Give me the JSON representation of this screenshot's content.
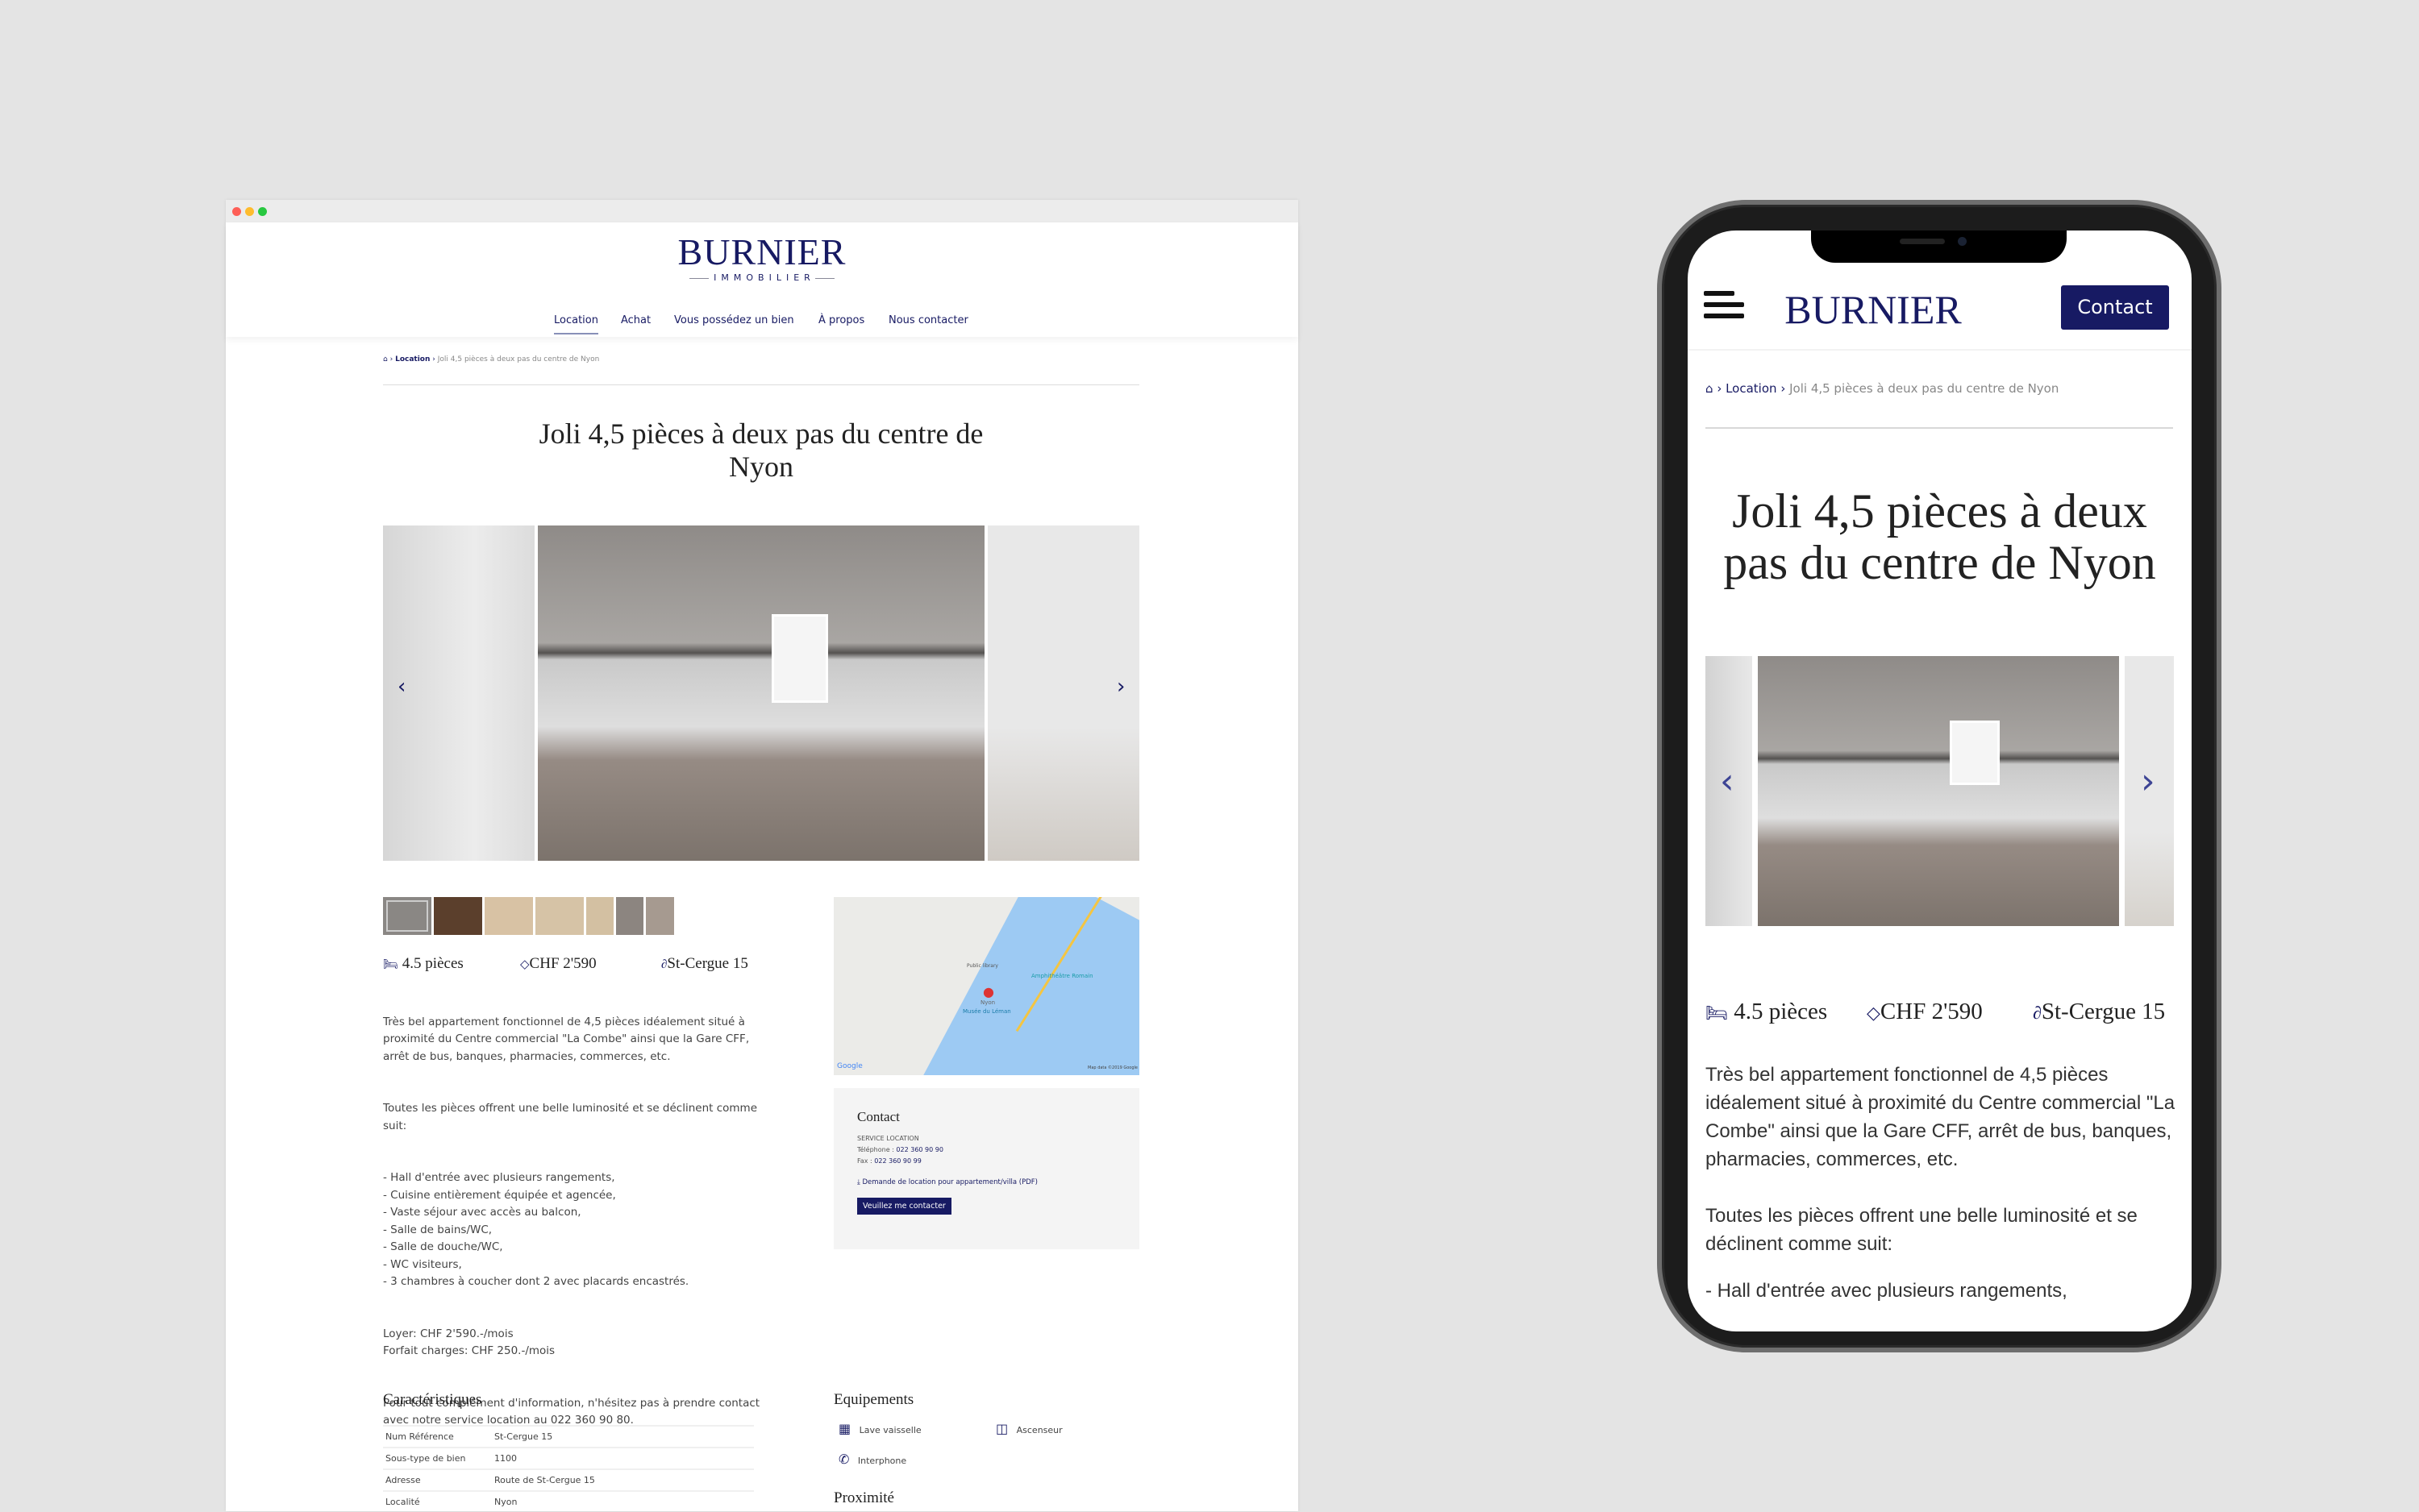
{
  "brand": {
    "name": "BURNIER",
    "tagline": "IMMOBILIER",
    "accent": "#171a63"
  },
  "nav": [
    "Location",
    "Achat",
    "Vous possédez un bien",
    "À propos",
    "Nous contacter"
  ],
  "breadcrumb": {
    "home": "home-icon",
    "section": "Location",
    "current": "Joli 4,5 pièces à deux pas du centre de Nyon"
  },
  "title": "Joli 4,5 pièces à deux pas du centre de Nyon",
  "specs": {
    "rooms": "4.5 pièces",
    "price": "CHF 2'590",
    "ref": "St-Cergue 15"
  },
  "description": {
    "p1": "Très bel appartement fonctionnel de 4,5 pièces idéalement situé à proximité du Centre commercial \"La Combe\" ainsi que la Gare CFF, arrêt de bus, banques, pharmacies, commerces, etc.",
    "p2": "Toutes les pièces offrent une belle luminosité et se déclinent comme suit:",
    "list": [
      "- Hall d'entrée avec plusieurs rangements,",
      "- Cuisine entièrement équipée et agencée,",
      "- Vaste séjour avec accès au balcon,",
      "- Salle de bains/WC,",
      "- Salle de douche/WC,",
      "- WC visiteurs,",
      "- 3 chambres à coucher dont 2 avec placards encastrés."
    ],
    "p3": "Loyer: CHF 2'590.-/mois\nForfait charges: CHF 250.-/mois",
    "p4": "Pour tout complément d'information, n'hésitez pas à prendre contact avec notre service location au 022 360 90 80."
  },
  "map": {
    "labels": [
      "Public library",
      "Nyon",
      "Amphithéâtre Romain",
      "Musée du Léman"
    ],
    "google": "Google",
    "attribution": "Map data ©2019 Google"
  },
  "contact": {
    "heading": "Contact",
    "service": "SERVICE LOCATION",
    "phone_label": "Téléphone : ",
    "phone": "022 360 90 90",
    "fax_label": "Fax : ",
    "fax": "022 360 90 99",
    "pdf": "Demande de location pour appartement/villa (PDF)",
    "button": "Veuillez me contacter"
  },
  "characteristics": {
    "heading": "Caractéristiques",
    "rows": [
      [
        "Num Référence",
        "St-Cergue 15"
      ],
      [
        "Sous-type de bien",
        "1100"
      ],
      [
        "Adresse",
        "Route de St-Cergue 15"
      ],
      [
        "Localité",
        "Nyon"
      ]
    ]
  },
  "equipment": {
    "heading": "Equipements",
    "items": [
      "Lave vaisselle",
      "Ascenseur",
      "Interphone"
    ]
  },
  "proximity": {
    "heading": "Proximité"
  },
  "mobile": {
    "contact_button": "Contact",
    "text_p1": "Très bel appartement fonctionnel de 4,5 pièces idéalement situé à proximité du Centre commercial \"La Combe\" ainsi que la Gare CFF, arrêt de bus, banques, pharmacies, commerces, etc.",
    "text_p2": "Toutes les pièces offrent une belle luminosité et se déclinent comme suit:",
    "text_p3": "- Hall d'entrée avec plusieurs rangements,"
  }
}
